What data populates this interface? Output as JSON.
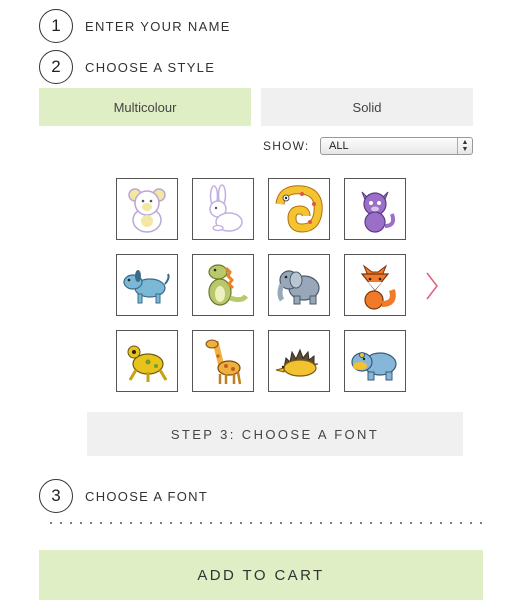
{
  "steps": [
    {
      "number": "1",
      "label": "ENTER YOUR NAME"
    },
    {
      "number": "2",
      "label": "CHOOSE A STYLE"
    },
    {
      "number": "3",
      "label": "CHOOSE A FONT"
    }
  ],
  "style_options": {
    "multicolour": "Multicolour",
    "solid": "Solid",
    "selected": "Multicolour"
  },
  "filter": {
    "label": "SHOW:",
    "value": "ALL"
  },
  "animals": [
    {
      "name": "teddy-bear-icon",
      "color": "#f3e7a3"
    },
    {
      "name": "bunny-icon",
      "color": "#d8c8ec"
    },
    {
      "name": "chameleon-icon",
      "color": "#f4c430"
    },
    {
      "name": "cat-icon",
      "color": "#9b6fc7"
    },
    {
      "name": "dog-icon",
      "color": "#7ab8d6"
    },
    {
      "name": "dinosaur-icon",
      "color": "#b8c86a"
    },
    {
      "name": "elephant-icon",
      "color": "#98a8b8"
    },
    {
      "name": "fox-icon",
      "color": "#f07a2a"
    },
    {
      "name": "frog-icon",
      "color": "#e8c21d"
    },
    {
      "name": "giraffe-icon",
      "color": "#f0b040"
    },
    {
      "name": "hedgehog-icon",
      "color": "#f2c230"
    },
    {
      "name": "hippo-icon",
      "color": "#86b6d8"
    }
  ],
  "next_icon": "chevron-right-icon",
  "font_step_button": "STEP 3: CHOOSE A FONT",
  "add_to_cart": "ADD TO CART",
  "colors": {
    "accent_green": "#dfeec4",
    "arrow_pink": "#e0607a"
  }
}
